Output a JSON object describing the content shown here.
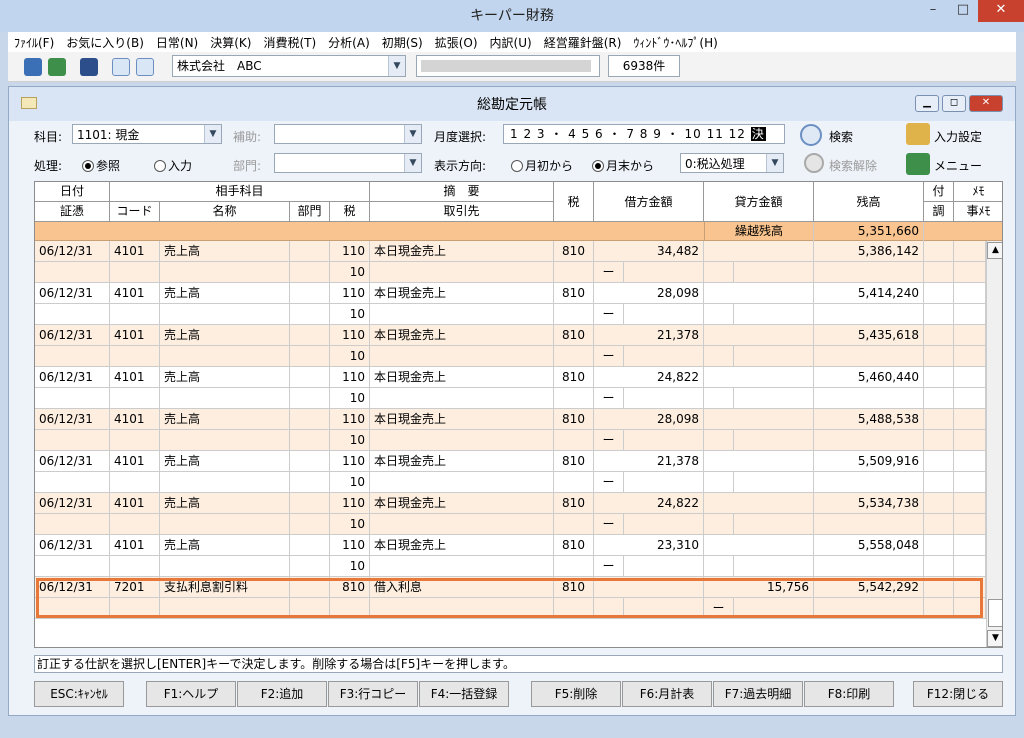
{
  "window": {
    "title": "キーパー財務"
  },
  "menu": [
    "ﾌｧｲﾙ(F)",
    "お気に入り(B)",
    "日常(N)",
    "決算(K)",
    "消費税(T)",
    "分析(A)",
    "初期(S)",
    "拡張(O)",
    "内訳(U)",
    "経営羅針盤(R)",
    "ｳｨﾝﾄﾞｳ･ﾍﾙﾌﾟ(H)"
  ],
  "toolbar": {
    "company": "株式会社　ABC",
    "count": "6938件"
  },
  "ledger": {
    "title": "総勘定元帳",
    "kamoku_label": "科目:",
    "kamoku_value": "1101: 現金",
    "hojo_label": "補助:",
    "month_label": "月度選択:",
    "months": "1 2 3 ・ 4 5 6 ・ 7 8 9 ・ 10 11 12",
    "month_selected": "決",
    "search": "検索",
    "input_settings": "入力設定",
    "process_label": "処理:",
    "radio_view": "参照",
    "radio_input": "入力",
    "bumon_label": "部門:",
    "direction_label": "表示方向:",
    "dir_start": "月初から",
    "dir_end": "月末から",
    "tax_select": "0:税込処理",
    "search_clear": "検索解除",
    "menu_btn": "メニュー"
  },
  "table_headers": {
    "date": "日付",
    "voucher": "証憑",
    "partner": "相手科目",
    "code": "コード",
    "name": "名称",
    "dept": "部門",
    "tax": "税",
    "memo1": "摘　要",
    "client": "取引先",
    "tax2": "税",
    "debit": "借方金額",
    "credit": "貸方金額",
    "balance": "残高",
    "attach": "付",
    "adjust": "調",
    "memo": "ﾒﾓ",
    "memo_item": "事ﾒﾓ"
  },
  "carry": {
    "label": "繰越残高",
    "balance": "5,351,660"
  },
  "rows": [
    {
      "date": "06/12/31",
      "code": "4101",
      "name": "売上高",
      "tax": "110",
      "tax_sub": "10",
      "desc": "本日現金売上",
      "tax2": "810",
      "debit": "34,482",
      "credit": "",
      "balance": "5,386,142",
      "dash": "ー",
      "dash_col": "debit"
    },
    {
      "date": "06/12/31",
      "code": "4101",
      "name": "売上高",
      "tax": "110",
      "tax_sub": "10",
      "desc": "本日現金売上",
      "tax2": "810",
      "debit": "28,098",
      "credit": "",
      "balance": "5,414,240",
      "dash": "ー",
      "dash_col": "debit"
    },
    {
      "date": "06/12/31",
      "code": "4101",
      "name": "売上高",
      "tax": "110",
      "tax_sub": "10",
      "desc": "本日現金売上",
      "tax2": "810",
      "debit": "21,378",
      "credit": "",
      "balance": "5,435,618",
      "dash": "ー",
      "dash_col": "debit"
    },
    {
      "date": "06/12/31",
      "code": "4101",
      "name": "売上高",
      "tax": "110",
      "tax_sub": "10",
      "desc": "本日現金売上",
      "tax2": "810",
      "debit": "24,822",
      "credit": "",
      "balance": "5,460,440",
      "dash": "ー",
      "dash_col": "debit"
    },
    {
      "date": "06/12/31",
      "code": "4101",
      "name": "売上高",
      "tax": "110",
      "tax_sub": "10",
      "desc": "本日現金売上",
      "tax2": "810",
      "debit": "28,098",
      "credit": "",
      "balance": "5,488,538",
      "dash": "ー",
      "dash_col": "debit"
    },
    {
      "date": "06/12/31",
      "code": "4101",
      "name": "売上高",
      "tax": "110",
      "tax_sub": "10",
      "desc": "本日現金売上",
      "tax2": "810",
      "debit": "21,378",
      "credit": "",
      "balance": "5,509,916",
      "dash": "ー",
      "dash_col": "debit"
    },
    {
      "date": "06/12/31",
      "code": "4101",
      "name": "売上高",
      "tax": "110",
      "tax_sub": "10",
      "desc": "本日現金売上",
      "tax2": "810",
      "debit": "24,822",
      "credit": "",
      "balance": "5,534,738",
      "dash": "ー",
      "dash_col": "debit"
    },
    {
      "date": "06/12/31",
      "code": "4101",
      "name": "売上高",
      "tax": "110",
      "tax_sub": "10",
      "desc": "本日現金売上",
      "tax2": "810",
      "debit": "23,310",
      "credit": "",
      "balance": "5,558,048",
      "dash": "ー",
      "dash_col": "debit"
    },
    {
      "date": "06/12/31",
      "code": "7201",
      "name": "支払利息割引料",
      "tax": "810",
      "tax_sub": "",
      "desc": "借入利息",
      "tax2": "810",
      "debit": "",
      "credit": "15,756",
      "balance": "5,542,292",
      "dash": "ー",
      "dash_col": "credit"
    }
  ],
  "status_text": "訂正する仕訳を選択し[ENTER]キーで決定します。削除する場合は[F5]キーを押します。",
  "fkeys": [
    "ESC:ｷｬﾝｾﾙ",
    "F1:ヘルプ",
    "F2:追加",
    "F3:行コピー",
    "F4:一括登録",
    "F5:削除",
    "F6:月計表",
    "F7:過去明細",
    "F8:印刷",
    "F12:閉じる"
  ]
}
